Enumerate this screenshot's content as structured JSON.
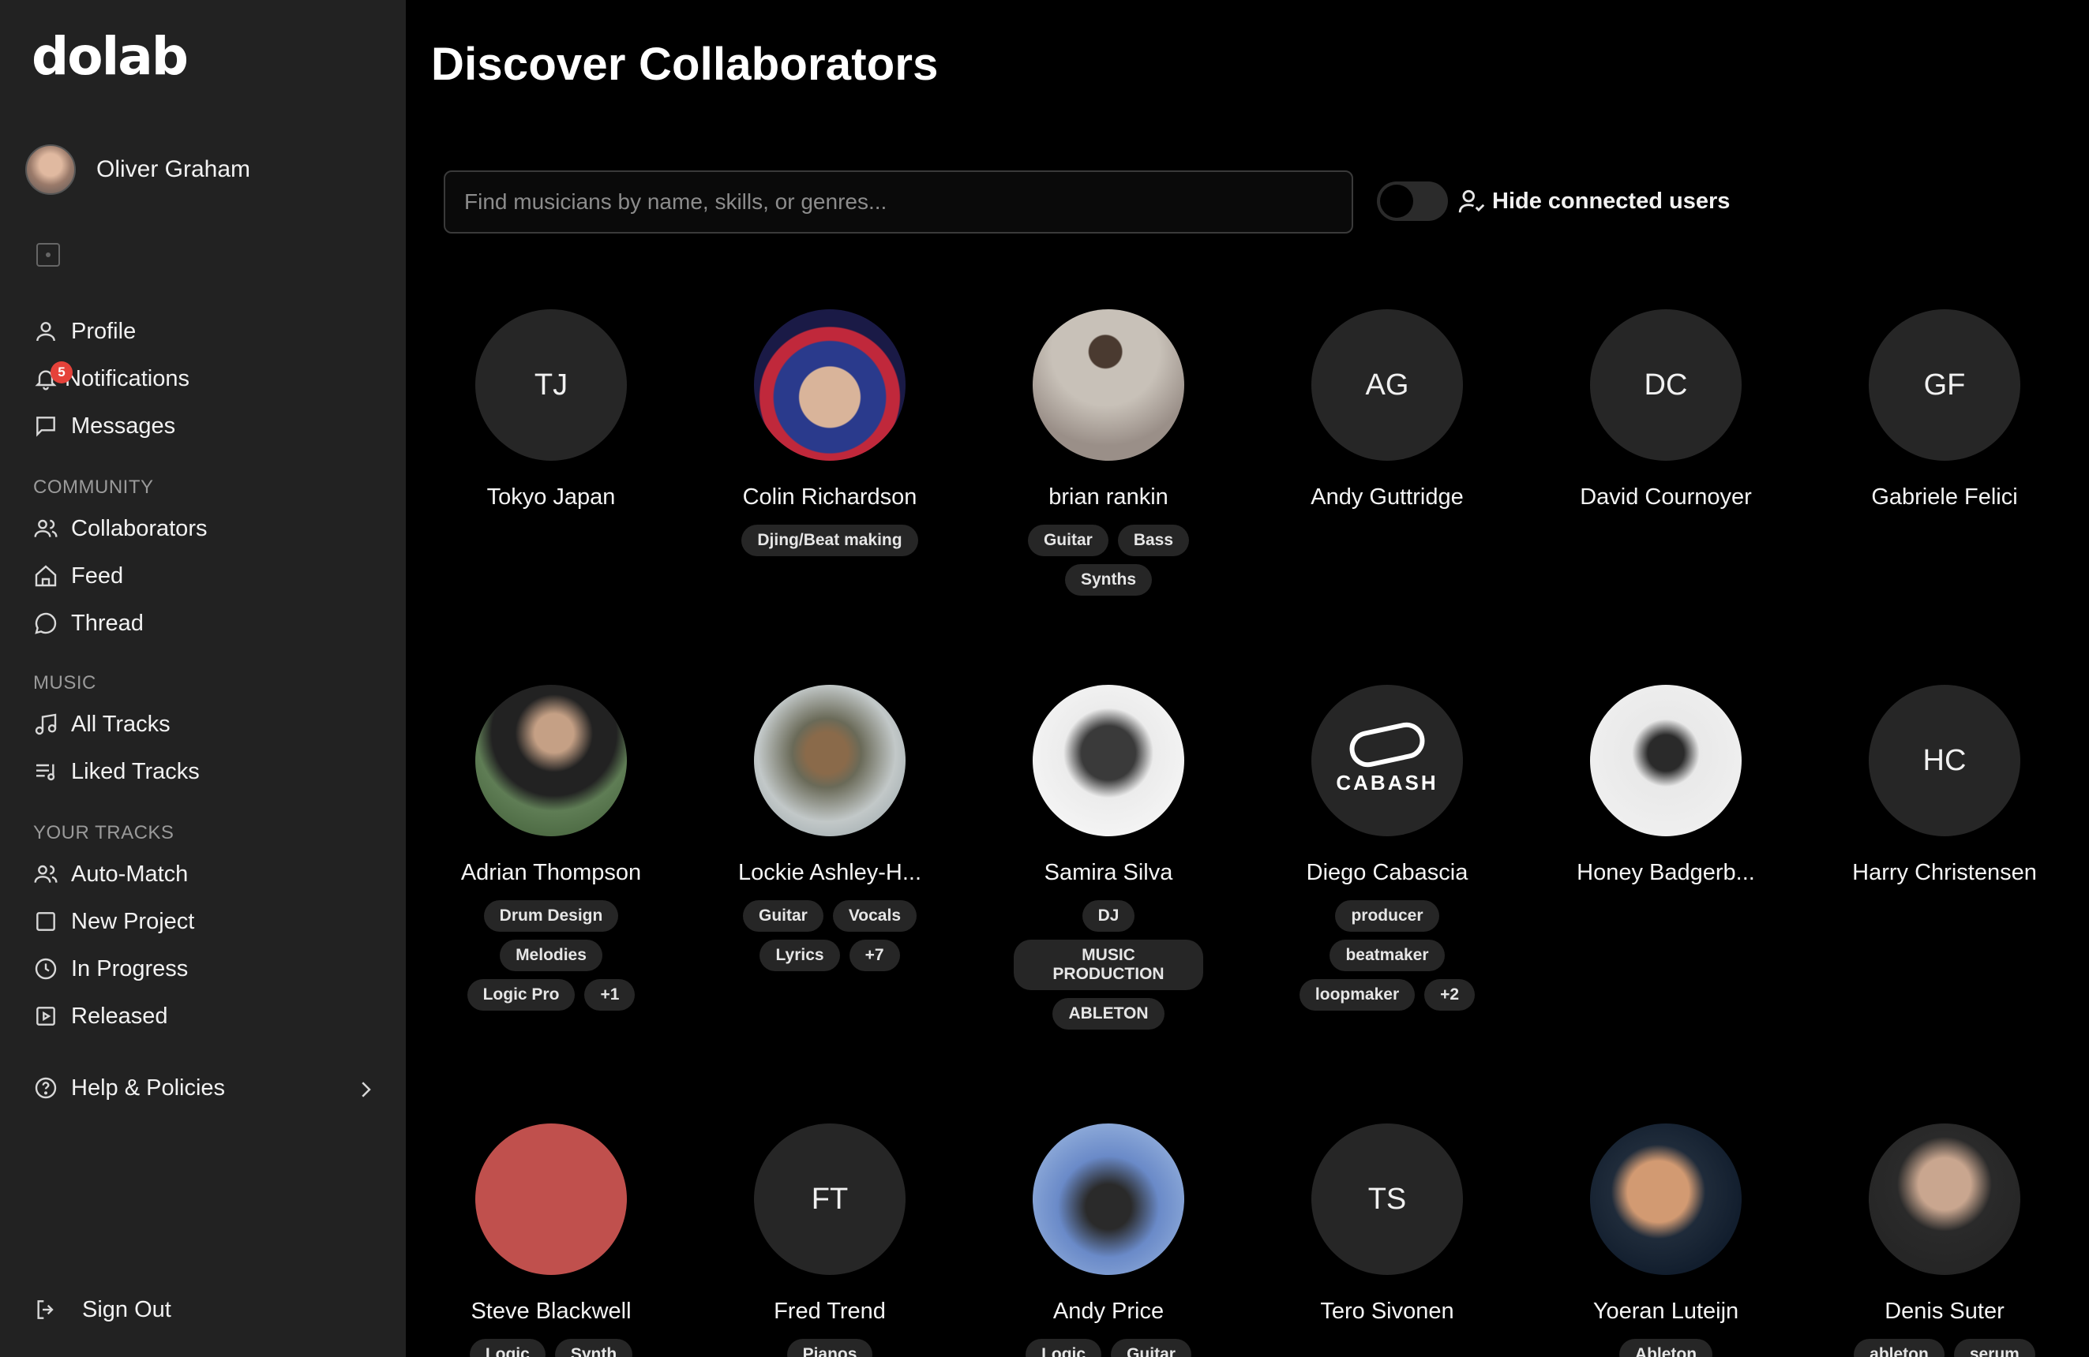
{
  "app": {
    "logo": "dolab"
  },
  "user": {
    "name": "Oliver Graham"
  },
  "sidebar": {
    "top_items": [
      {
        "label": "Profile",
        "icon": "user-icon"
      },
      {
        "label": "Notifications",
        "icon": "bell-icon",
        "badge": "5"
      },
      {
        "label": "Messages",
        "icon": "message-icon"
      }
    ],
    "sections": [
      {
        "title": "COMMUNITY",
        "items": [
          {
            "label": "Collaborators",
            "icon": "users-icon"
          },
          {
            "label": "Feed",
            "icon": "home-icon"
          },
          {
            "label": "Thread",
            "icon": "chat-bubble-icon"
          }
        ]
      },
      {
        "title": "MUSIC",
        "items": [
          {
            "label": "All Tracks",
            "icon": "music-note-icon"
          },
          {
            "label": "Liked Tracks",
            "icon": "list-music-icon"
          }
        ]
      },
      {
        "title": "YOUR TRACKS",
        "items": [
          {
            "label": "Auto-Match",
            "icon": "users-icon"
          },
          {
            "label": "New Project",
            "icon": "square-icon"
          },
          {
            "label": "In Progress",
            "icon": "clock-icon"
          },
          {
            "label": "Released",
            "icon": "play-square-icon"
          }
        ]
      }
    ],
    "help": {
      "label": "Help & Policies",
      "icon": "help-circle-icon"
    },
    "signout": {
      "label": "Sign Out",
      "icon": "sign-out-icon"
    }
  },
  "main": {
    "title": "Discover Collaborators",
    "search": {
      "placeholder": "Find musicians by name, skills, or genres...",
      "value": ""
    },
    "hide_connected": {
      "label": "Hide connected users",
      "enabled": false
    }
  },
  "collaborators": [
    {
      "name": "Tokyo Japan",
      "initials": "TJ",
      "tags": []
    },
    {
      "name": "Colin Richardson",
      "initials": "",
      "tags": [
        "Djing/Beat making"
      ]
    },
    {
      "name": "brian rankin",
      "initials": "",
      "tags": [
        "Guitar",
        "Bass",
        "Synths"
      ]
    },
    {
      "name": "Andy Guttridge",
      "initials": "AG",
      "tags": []
    },
    {
      "name": "David Cournoyer",
      "initials": "DC",
      "tags": []
    },
    {
      "name": "Gabriele Felici",
      "initials": "GF",
      "tags": []
    },
    {
      "name": "Adrian Thompson",
      "initials": "",
      "tags": [
        "Drum Design",
        "Melodies",
        "Logic Pro",
        "+1"
      ]
    },
    {
      "name": "Lockie Ashley-H...",
      "initials": "",
      "tags": [
        "Guitar",
        "Vocals",
        "Lyrics",
        "+7"
      ]
    },
    {
      "name": "Samira Silva",
      "initials": "",
      "tags": [
        "DJ",
        "MUSIC PRODUCTION",
        "ABLETON"
      ]
    },
    {
      "name": "Diego Cabascia",
      "initials": "",
      "avatar_text": "CABASH",
      "tags": [
        "producer",
        "beatmaker",
        "loopmaker",
        "+2"
      ]
    },
    {
      "name": "Honey Badgerb...",
      "initials": "",
      "tags": []
    },
    {
      "name": "Harry Christensen",
      "initials": "HC",
      "tags": []
    },
    {
      "name": "Steve Blackwell",
      "initials": "",
      "tags": [
        "Logic",
        "Synth"
      ]
    },
    {
      "name": "Fred Trend",
      "initials": "FT",
      "tags": [
        "Pianos"
      ]
    },
    {
      "name": "Andy Price",
      "initials": "",
      "tags": [
        "Logic",
        "Guitar"
      ]
    },
    {
      "name": "Tero Sivonen",
      "initials": "TS",
      "tags": []
    },
    {
      "name": "Yoeran Luteijn",
      "initials": "",
      "tags": [
        "Ableton"
      ]
    },
    {
      "name": "Denis Suter",
      "initials": "",
      "tags": [
        "ableton",
        "serum"
      ]
    }
  ]
}
